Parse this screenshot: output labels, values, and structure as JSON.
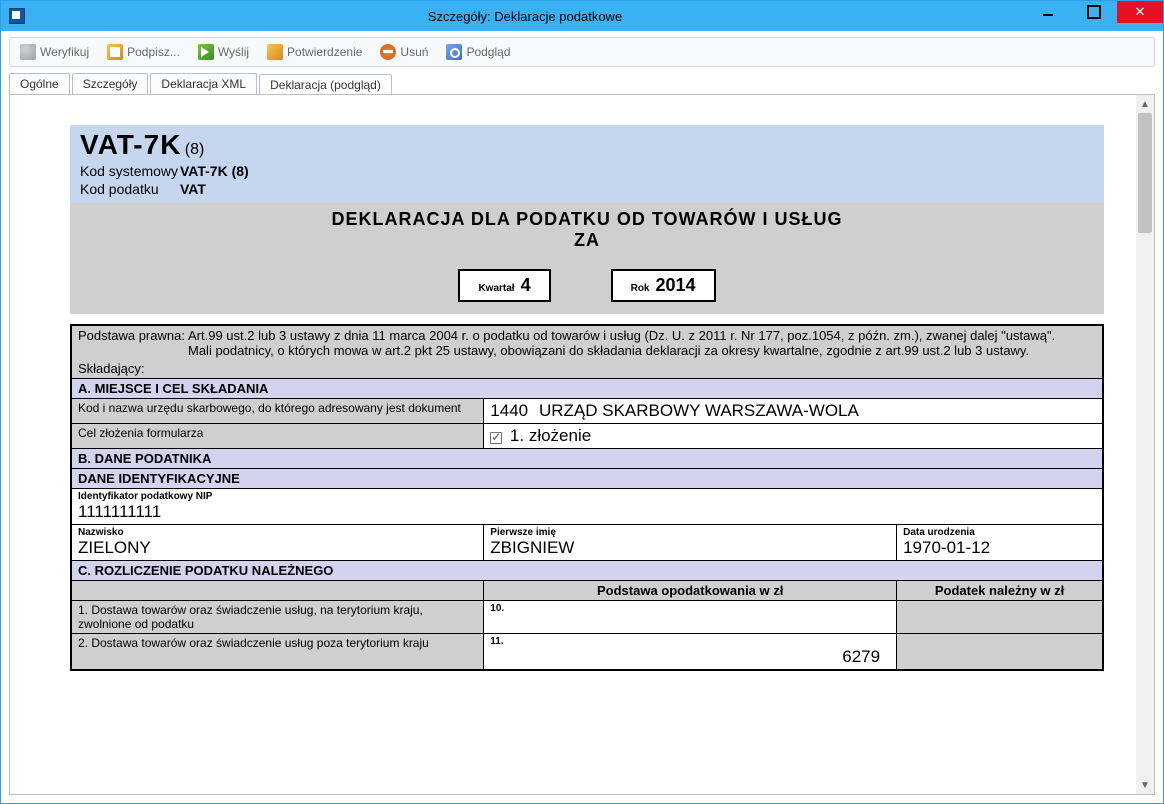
{
  "window": {
    "title": "Szczegóły: Deklaracje podatkowe"
  },
  "toolbar": {
    "verify": "Weryfikuj",
    "sign": "Podpisz...",
    "send": "Wyślij",
    "confirm": "Potwierdzenie",
    "delete": "Usuń",
    "preview": "Podgląd"
  },
  "tabs": {
    "general": "Ogólne",
    "details": "Szczegóły",
    "xml": "Deklaracja XML",
    "preview": "Deklaracja (podgląd)"
  },
  "doc": {
    "form_code": "VAT-7K",
    "form_ver": "(8)",
    "sys_code_label": "Kod systemowy",
    "sys_code_value": "VAT-7K (8)",
    "tax_code_label": "Kod podatku",
    "tax_code_value": "VAT",
    "title_line1": "DEKLARACJA DLA PODATKU OD TOWARÓW I USŁUG",
    "title_line2": "ZA",
    "quarter_label": "Kwartał",
    "quarter_value": "4",
    "year_label": "Rok",
    "year_value": "2014",
    "legal_basis_label": "Podstawa prawna:",
    "legal_basis_text": "Art.99 ust.2 lub 3 ustawy z dnia 11 marca 2004 r. o podatku od towarów i usług (Dz. U. z 2011 r. Nr 177, poz.1054, z późn. zm.), zwanej dalej \"ustawą\".",
    "filer_label": "Składający:",
    "filer_text": "Mali podatnicy, o których mowa w art.2 pkt 25 ustawy, obowiązani do składania deklaracji za okresy kwartalne, zgodnie z art.99 ust.2 lub 3 ustawy.",
    "secA_title": "A. MIEJSCE I CEL SKŁADANIA",
    "office_label": "Kod i nazwa urzędu skarbowego, do którego adresowany jest dokument",
    "office_code": "1440",
    "office_name": "URZĄD SKARBOWY WARSZAWA-WOLA",
    "purpose_label": "Cel złożenia formularza",
    "purpose_value": "1. złożenie",
    "secB_title": "B. DANE PODATNIKA",
    "secB_sub": "DANE IDENTYFIKACYJNE",
    "nip_label": "Identyfikator podatkowy NIP",
    "nip_value": "1111111111",
    "surname_label": "Nazwisko",
    "surname_value": "ZIELONY",
    "firstname_label": "Pierwsze imię",
    "firstname_value": "ZBIGNIEW",
    "dob_label": "Data urodzenia",
    "dob_value": "1970-01-12",
    "secC_title": "C. ROZLICZENIE PODATKU NALEŻNEGO",
    "col_base": "Podstawa opodatkowania w zł",
    "col_tax": "Podatek należny w zł",
    "row1_label": "1. Dostawa towarów oraz świadczenie usług, na terytorium kraju, zwolnione od podatku",
    "row1_box": "10.",
    "row2_label": "2. Dostawa towarów oraz świadczenie usług poza terytorium kraju",
    "row2_box": "11.",
    "row2_value": "6279"
  }
}
